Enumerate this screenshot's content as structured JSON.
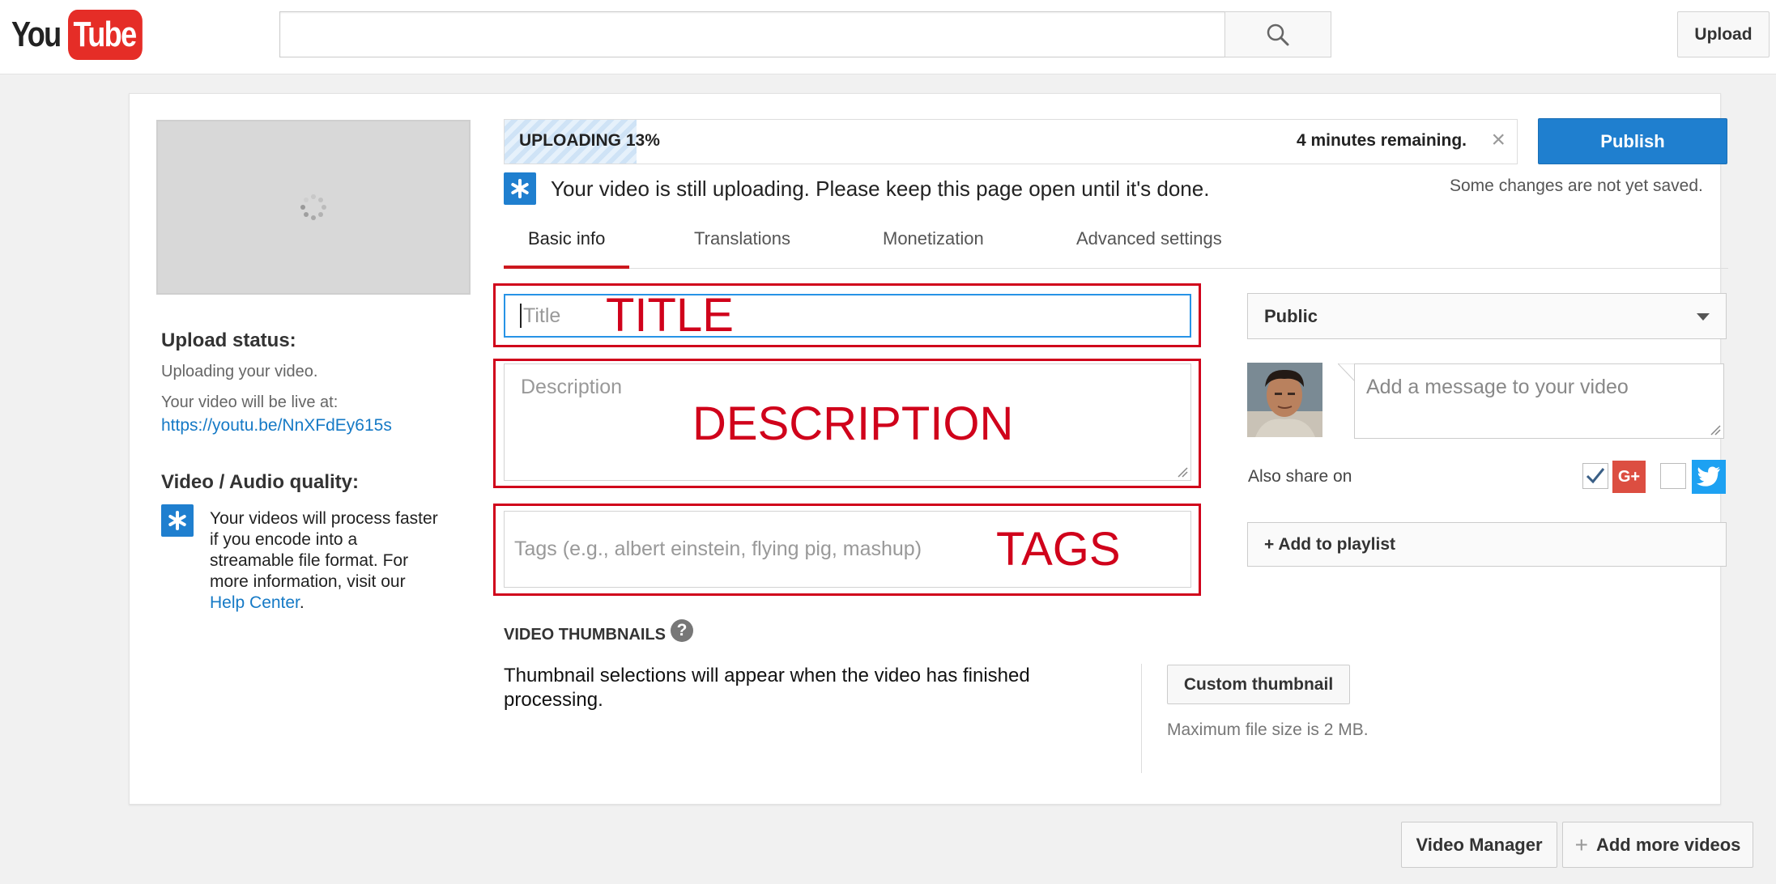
{
  "masthead": {
    "logo_you": "You",
    "logo_tube": "Tube",
    "search_placeholder": "",
    "upload_label": "Upload"
  },
  "upload": {
    "progress_label": "UPLOADING 13%",
    "progress_fraction": 0.13,
    "remaining": "4 minutes remaining.",
    "close_glyph": "×",
    "publish_label": "Publish",
    "unsaved": "Some changes are not yet saved.",
    "notice": "Your video is still uploading. Please keep this page open until it's done."
  },
  "tabs": [
    {
      "label": "Basic info",
      "active": true
    },
    {
      "label": "Translations",
      "active": false
    },
    {
      "label": "Monetization",
      "active": false
    },
    {
      "label": "Advanced settings",
      "active": false
    }
  ],
  "sidebar": {
    "status_heading": "Upload status:",
    "status_text": "Uploading your video.",
    "live_text": "Your video will be live at:",
    "live_url": "https://youtu.be/NnXFdEy615s",
    "quality_heading": "Video / Audio quality:",
    "quality_note": "Your videos will process faster if you encode into a streamable file format. For more information, visit our",
    "help_link": "Help Center",
    "help_suffix": "."
  },
  "form": {
    "title_placeholder": "Title",
    "title_annotation": "TITLE",
    "description_placeholder": "Description",
    "description_annotation": "DESCRIPTION",
    "tags_placeholder": "Tags (e.g., albert einstein, flying pig, mashup)",
    "tags_annotation": "TAGS",
    "annotation_color": "#d0021b"
  },
  "right_panel": {
    "privacy_value": "Public",
    "message_placeholder": "Add a message to your video",
    "share_label": "Also share on",
    "gplus_label": "G+",
    "gplus_checked": true,
    "twitter_checked": false,
    "playlist_label": "+ Add to playlist"
  },
  "thumbnails": {
    "heading": "VIDEO THUMBNAILS",
    "help_glyph": "?",
    "text": "Thumbnail selections will appear when the video has finished processing.",
    "custom_label": "Custom thumbnail",
    "max_size": "Maximum file size is 2 MB."
  },
  "footer": {
    "video_manager": "Video Manager",
    "add_more": "Add more videos",
    "add_more_glyph": "+"
  },
  "colors": {
    "brand_red": "#e52d27",
    "accent_blue": "#1f7fcf",
    "tab_underline": "#cc181e"
  }
}
